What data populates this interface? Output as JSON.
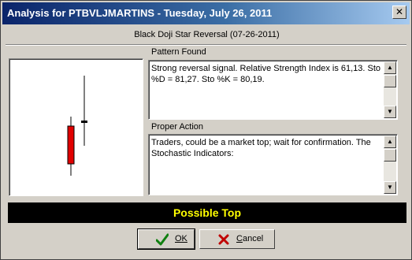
{
  "window": {
    "title": "Analysis for PTBVLJMARTINS - Tuesday, July 26, 2011",
    "close_glyph": "✕"
  },
  "pattern_title": "Black Doji Star Reversal (07-26-2011)",
  "pattern_found": {
    "label": "Pattern Found",
    "text": "Strong reversal signal. Relative Strength Index is 61,13. Sto %D = 81,27. Sto %K = 80,19."
  },
  "proper_action": {
    "label": "Proper Action",
    "text": "Traders, could be a market top; wait for confirmation. The Stochastic Indicators:"
  },
  "banner": {
    "text": "Possible Top",
    "text_color": "#ffff00",
    "background": "#000000"
  },
  "buttons": {
    "ok_label": "OK",
    "cancel_label": "Cancel"
  },
  "icons": {
    "ok": "check-icon",
    "cancel": "x-icon",
    "close": "close-icon",
    "scroll_up": "scroll-up-arrow-icon",
    "scroll_down": "scroll-down-arrow-icon"
  },
  "candles": {
    "first": {
      "color": "#e00000",
      "type": "bearish"
    },
    "second": {
      "color": "#000000",
      "type": "doji"
    }
  }
}
